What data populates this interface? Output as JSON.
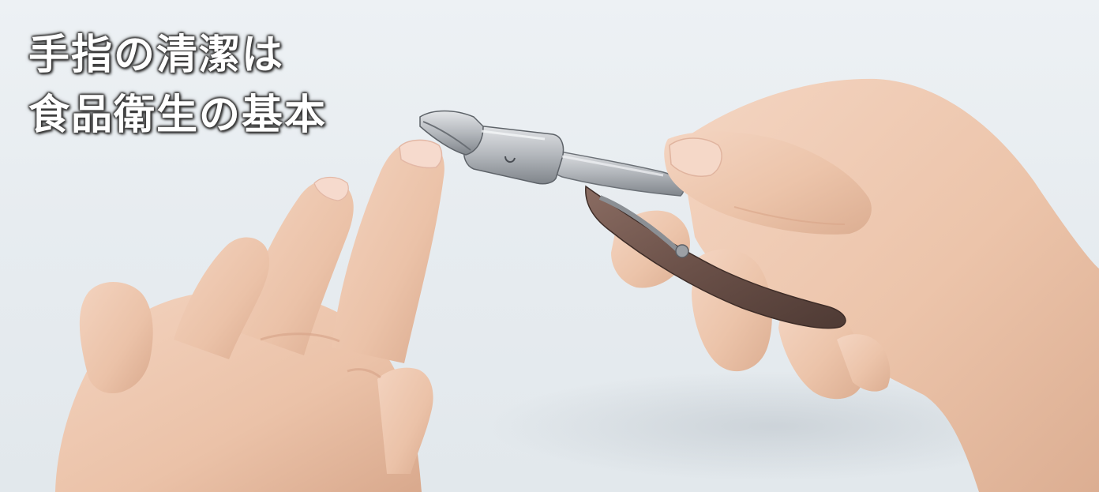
{
  "headline": {
    "line1": "手指の清潔は",
    "line2": "食品衛生の基本"
  },
  "illustration": {
    "subject": "nail-nipper-in-hand",
    "colors": {
      "background": "#e9eef2",
      "skin": "#efc9b1",
      "skin_shadow": "#d9a98d",
      "nail": "#f4d7cb",
      "steel": "#b9bcc0",
      "steel_dark": "#7d8186",
      "handle_brown": "#6a5048"
    }
  }
}
